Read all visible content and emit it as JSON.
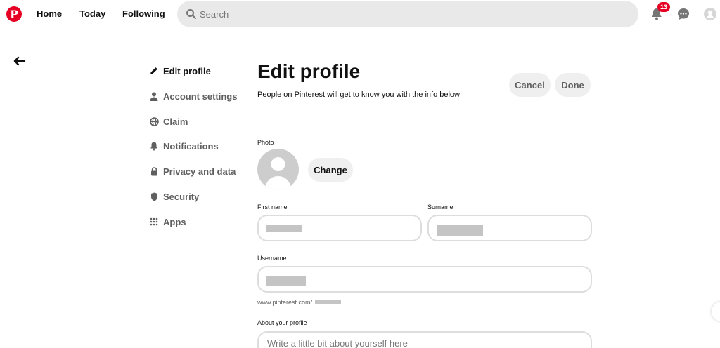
{
  "nav": {
    "home": "Home",
    "today": "Today",
    "following": "Following",
    "search_placeholder": "Search",
    "notification_count": "13",
    "brand_color": "#e60023"
  },
  "sidebar": {
    "items": [
      {
        "label": "Edit profile",
        "icon": "pencil-icon",
        "active": true
      },
      {
        "label": "Account settings",
        "icon": "person-icon",
        "active": false
      },
      {
        "label": "Claim",
        "icon": "globe-icon",
        "active": false
      },
      {
        "label": "Notifications",
        "icon": "bell-icon",
        "active": false
      },
      {
        "label": "Privacy and data",
        "icon": "lock-icon",
        "active": false
      },
      {
        "label": "Security",
        "icon": "shield-icon",
        "active": false
      },
      {
        "label": "Apps",
        "icon": "grid-icon",
        "active": false
      }
    ]
  },
  "main": {
    "title": "Edit profile",
    "subtitle": "People on Pinterest will get to know you with the info below",
    "cancel_label": "Cancel",
    "done_label": "Done",
    "photo_label": "Photo",
    "change_label": "Change",
    "first_name_label": "First name",
    "surname_label": "Surname",
    "username_label": "Username",
    "url_prefix": "www.pinterest.com/",
    "about_label": "About your profile",
    "about_placeholder": "Write a little bit about yourself here"
  }
}
